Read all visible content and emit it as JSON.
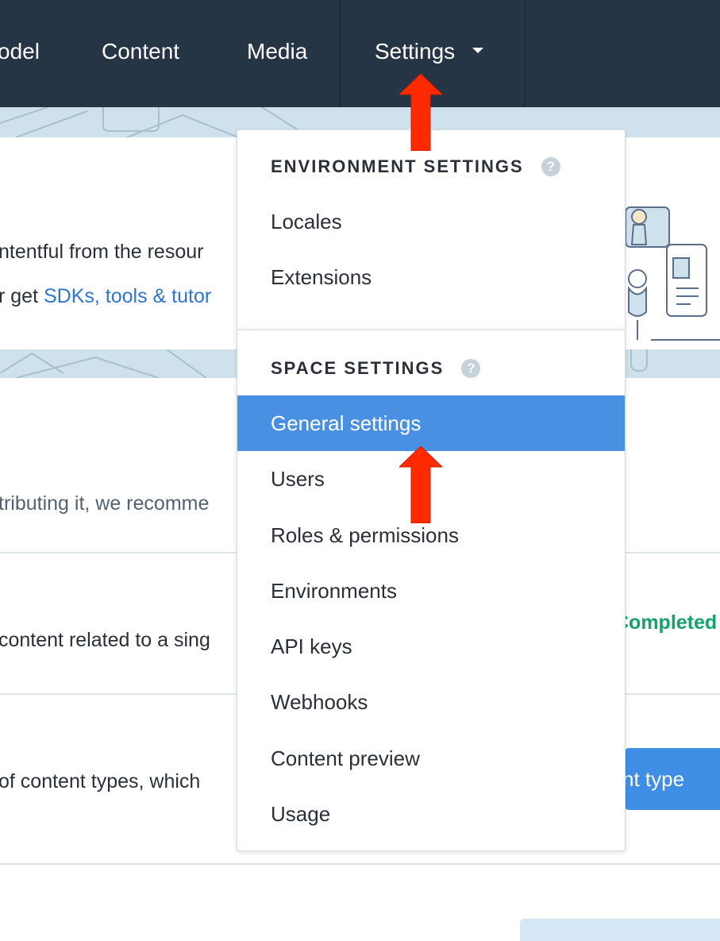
{
  "nav": {
    "items": [
      {
        "label": "odel"
      },
      {
        "label": "Content"
      },
      {
        "label": "Media"
      },
      {
        "label": "Settings"
      }
    ]
  },
  "page": {
    "line1": "ntentful from the resour",
    "line2_prefix": "r get ",
    "line2_link": "SDKs, tools & tutor",
    "line3": "tributing it, we recomme",
    "line4": "content related to a sing",
    "status_completed": "Completed",
    "line5": "of content types, which",
    "content_type_button": "nt type"
  },
  "dropdown": {
    "environment_heading": "ENVIRONMENT SETTINGS",
    "environment_items": [
      {
        "label": "Locales"
      },
      {
        "label": "Extensions"
      }
    ],
    "space_heading": "SPACE SETTINGS",
    "space_items": [
      {
        "label": "General settings"
      },
      {
        "label": "Users"
      },
      {
        "label": "Roles & permissions"
      },
      {
        "label": "Environments"
      },
      {
        "label": "API keys"
      },
      {
        "label": "Webhooks"
      },
      {
        "label": "Content preview"
      },
      {
        "label": "Usage"
      }
    ],
    "help_glyph": "?"
  },
  "colors": {
    "nav_bg": "#263545",
    "active_item": "#4a90e2",
    "link": "#2e75d4",
    "success": "#14a36a",
    "annotation_arrow": "#ff2a00"
  }
}
